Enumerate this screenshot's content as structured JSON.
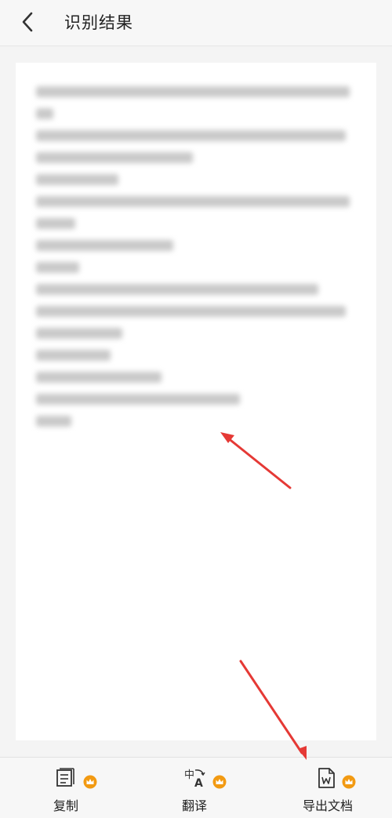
{
  "header": {
    "back_icon": "chevron-left-icon",
    "title": "识别结果"
  },
  "result": {
    "recognized_text_visible": false
  },
  "toolbar": {
    "copy_label": "复制",
    "translate_label": "翻译",
    "export_label": "导出文档",
    "vip_icon": "crown-icon"
  },
  "colors": {
    "accent": "#f29a12",
    "annotation": "#e53935"
  }
}
